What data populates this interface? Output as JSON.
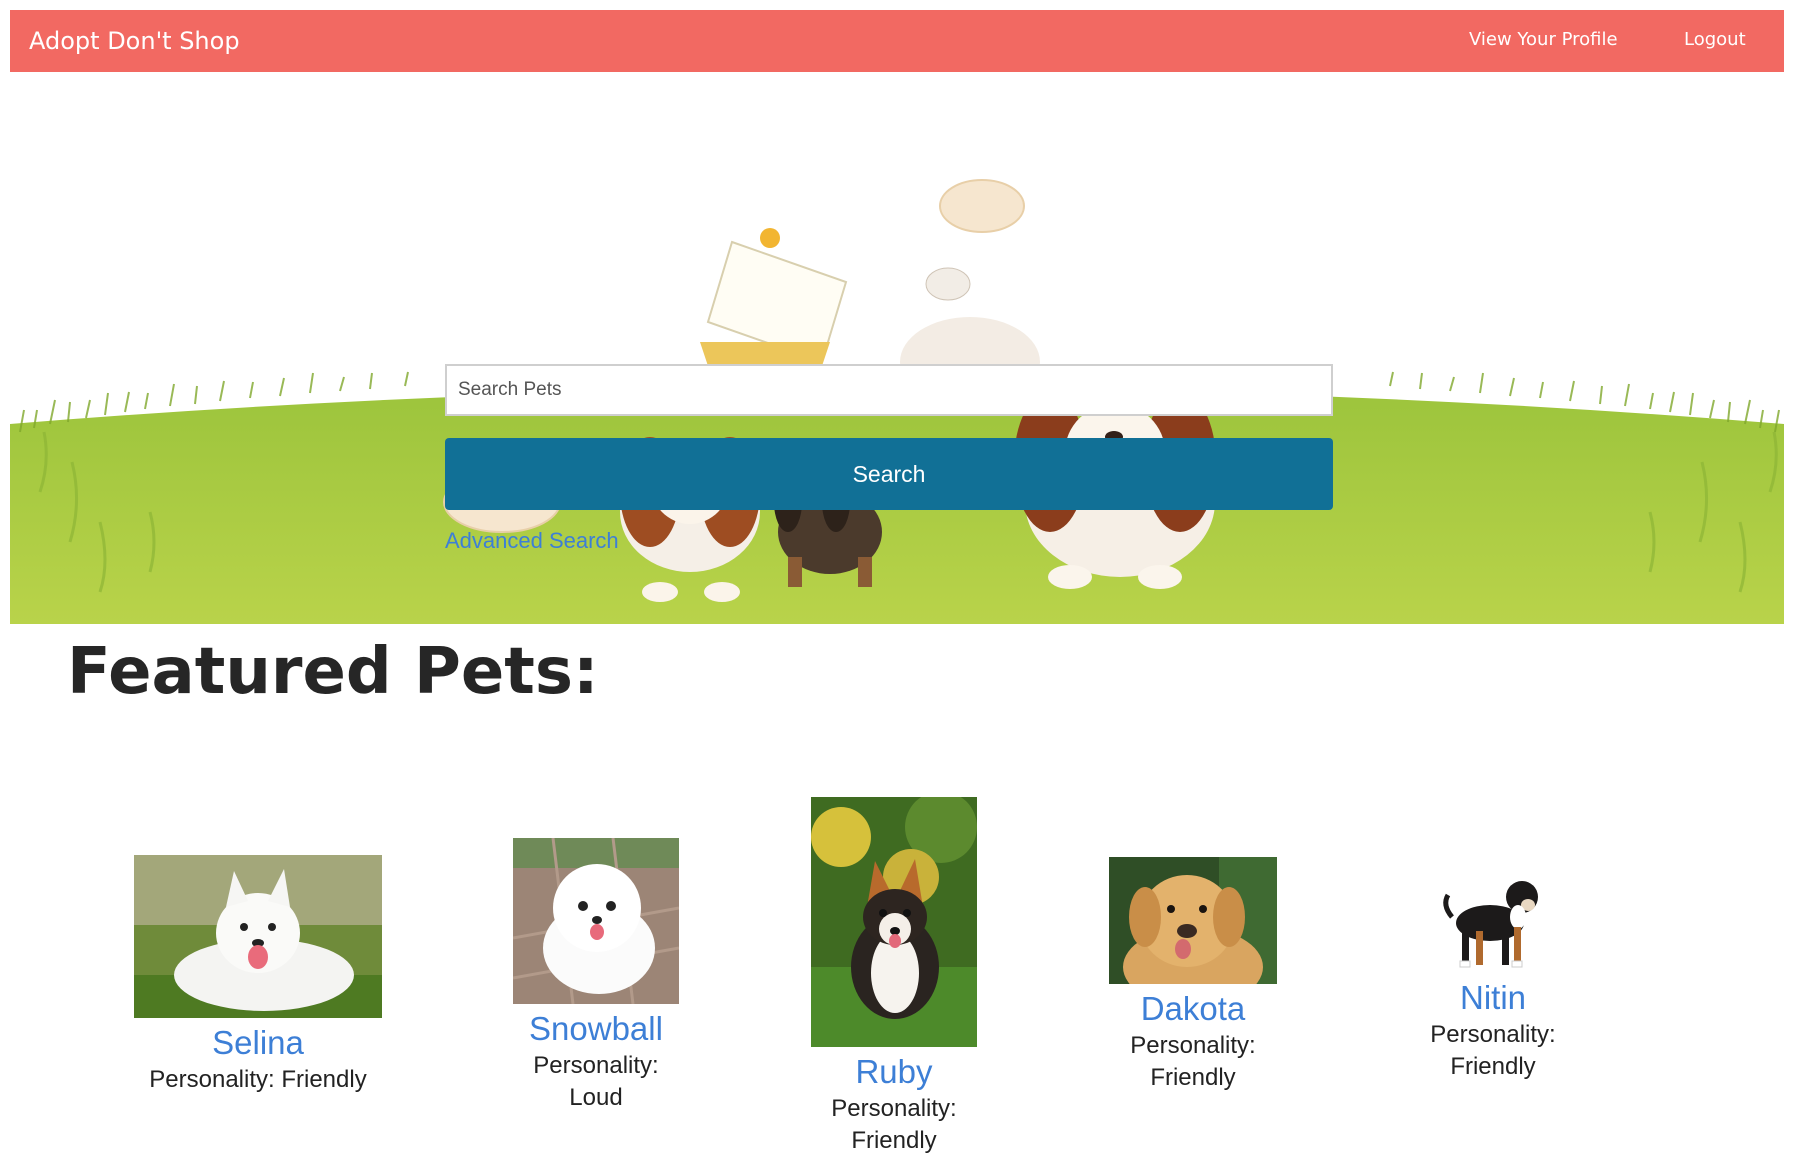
{
  "navbar": {
    "brand": "Adopt Don't Shop",
    "links": [
      {
        "label": "View Your Profile"
      },
      {
        "label": "Logout"
      }
    ],
    "color": "#f26962"
  },
  "search": {
    "placeholder": "Search Pets",
    "value": "",
    "button_label": "Search",
    "button_color": "#117096",
    "advanced_link": "Advanced Search"
  },
  "featured": {
    "title": "Featured Pets:",
    "pets": [
      {
        "name": "Selina",
        "personality": "Personality: Friendly"
      },
      {
        "name": "Snowball",
        "personality": "Personality: Loud"
      },
      {
        "name": "Ruby",
        "personality": "Personality: Friendly"
      },
      {
        "name": "Dakota",
        "personality": "Personality: Friendly"
      },
      {
        "name": "Nitin",
        "personality": "Personality: Friendly"
      }
    ]
  }
}
